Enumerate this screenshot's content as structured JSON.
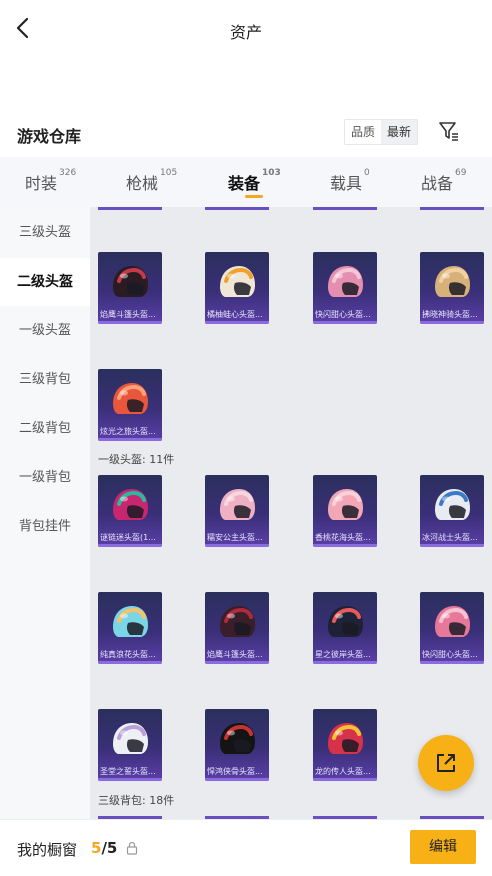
{
  "header": {
    "title": "资产"
  },
  "warehouse": {
    "title": "游戏仓库",
    "sort_options": [
      "品质",
      "最新"
    ]
  },
  "tabs": [
    {
      "label": "时装",
      "count": "326"
    },
    {
      "label": "枪械",
      "count": "105"
    },
    {
      "label": "装备",
      "count": "103",
      "active": true
    },
    {
      "label": "载具",
      "count": "0"
    },
    {
      "label": "战备",
      "count": "69"
    }
  ],
  "sidebar": [
    {
      "label": "三级头盔"
    },
    {
      "label": "二级头盔",
      "active": true
    },
    {
      "label": "一级头盔"
    },
    {
      "label": "三级背包"
    },
    {
      "label": "二级背包"
    },
    {
      "label": "一级背包"
    },
    {
      "label": "背包挂件"
    }
  ],
  "sections": {
    "level1_helmet": "一级头盔: 11件",
    "level3_backpack": "三级背包: 18件"
  },
  "items_level2": [
    {
      "label": "焰鹰斗篷头盔...",
      "colors": [
        "#2a1c22",
        "#c43a4a"
      ]
    },
    {
      "label": "橘柚蛙心头盔...",
      "colors": [
        "#f0e6d6",
        "#f0a12a"
      ]
    },
    {
      "label": "快闪甜心头盔...",
      "colors": [
        "#e58fb0",
        "#f4c6d6"
      ]
    },
    {
      "label": "拂晓神骑头盔...",
      "colors": [
        "#d8b07a",
        "#f0d2a0"
      ]
    },
    {
      "label": "炫光之旅头盔...",
      "colors": [
        "#e8563c",
        "#f7a27a"
      ]
    }
  ],
  "items_level1": [
    {
      "label": "谜链迷头盔(1...",
      "colors": [
        "#c8266e",
        "#2ab8a0"
      ]
    },
    {
      "label": "糯安公主头盔...",
      "colors": [
        "#f0b0c4",
        "#f8d6e0"
      ]
    },
    {
      "label": "香桃花海头盔...",
      "colors": [
        "#f2a6b6",
        "#f8d2da"
      ]
    },
    {
      "label": "冰河战士头盔...",
      "colors": [
        "#e8ecf2",
        "#3a7ac8"
      ]
    },
    {
      "label": "纯真浪花头盔...",
      "colors": [
        "#7ad6e6",
        "#f4c36a"
      ]
    },
    {
      "label": "焰鹰斗篷头盔...",
      "colors": [
        "#3a1e2a",
        "#b02a3a"
      ]
    },
    {
      "label": "星之彼岸头盔...",
      "colors": [
        "#1e2236",
        "#e85a5a"
      ]
    },
    {
      "label": "快闪甜心头盔...",
      "colors": [
        "#e8789a",
        "#f6c2d0"
      ]
    },
    {
      "label": "圣堂之誓头盔...",
      "colors": [
        "#eef0f6",
        "#b8a0d8"
      ]
    },
    {
      "label": "悍鸿侠骨头盔...",
      "colors": [
        "#141414",
        "#c83232"
      ]
    },
    {
      "label": "龙的传人头盔...",
      "colors": [
        "#d8324a",
        "#f0c23a"
      ]
    }
  ],
  "bottom": {
    "label": "我的橱窗",
    "current": "5",
    "total": "/5",
    "edit_label": "编辑"
  },
  "colors": {
    "accent": "#f7b016",
    "card_bg": "#3a2f78"
  }
}
